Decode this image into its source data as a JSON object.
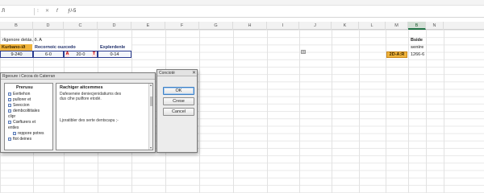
{
  "ribbon": {
    "labels": [
      "",
      "",
      "",
      "",
      "",
      "",
      "",
      "",
      ""
    ]
  },
  "formula_bar": {
    "name_box": "Л",
    "separator": "⁝",
    "cancel": "✕",
    "fx": "f",
    "content": "ƒ/-5"
  },
  "columns": [
    "B",
    "D",
    "C",
    "D",
    "E",
    "F",
    "G",
    "H",
    "I",
    "J",
    "K",
    "L",
    "M",
    "B",
    "N"
  ],
  "active_column": "B",
  "sheet": {
    "title": "rligenore detás, ð. A",
    "headers": [
      "Kurbano-ið",
      "Recornoic ouzcedo",
      "Explerdenle"
    ],
    "row": [
      "9-240",
      "6-0",
      "20·0",
      "0-14"
    ],
    "flag_a": "A",
    "flag_t": "T",
    "right_header": "Bside",
    "right_subheader": "senire",
    "badge": "2D-A:R",
    "right_value": "1266-6",
    "marker": "⊞"
  },
  "dialog": {
    "title": "Rgeoure i Cecoa do Caterran",
    "left_heading": "Prerusu",
    "tree_items": [
      "Eertiehon",
      "pullorer et",
      "Seeccion",
      "dembcoltitiales",
      "clipr",
      "Cœfturers et",
      "entles",
      "reppore potres",
      "ftot deines"
    ],
    "right_heading": "Rachiger aitcemmes",
    "body_line1": "Dafeseneie deniecjenidatiums des",
    "body_line2": "dus cihe puilfore etodé.",
    "body_line3": "Ljoratibler des serte dentscapu ;-"
  },
  "dialog2": {
    "title": "Conciotè",
    "close": "✕",
    "ok_label": "OK",
    "create_label": "Crese",
    "cancel_label": "Cancel"
  }
}
